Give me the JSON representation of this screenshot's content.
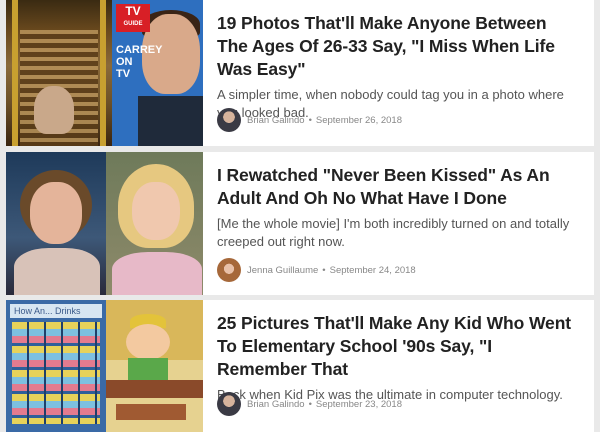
{
  "articles": [
    {
      "title": "19 Photos That'll Make Anyone Between The Ages Of 26-33 Say, \"I Miss When Life Was Easy\"",
      "description": "A simpler time, when nobody could tag you in a photo where you looked bad.",
      "author": "Brian Galindo",
      "date": "September 26, 2018",
      "thumb_text": {
        "tv_logo": "TV",
        "tv_logo_sub": "GUIDE",
        "cover_line": "CARREY ON TV"
      }
    },
    {
      "title": "I Rewatched \"Never Been Kissed\" As An Adult And Oh No What Have I Done",
      "description": "[Me the whole movie] I'm both incredibly turned on and totally creeped out right now.",
      "author": "Jenna Guillaume",
      "date": "September 24, 2018"
    },
    {
      "title": "25 Pictures That'll Make Any Kid Who Went To Elementary School '90s Say, \"I Remember That",
      "description": "Back when Kid Pix was the ultimate in computer technology.",
      "author": "Brian Galindo",
      "date": "September 23, 2018",
      "thumb_text": {
        "banner": "How An... Drinks"
      }
    }
  ],
  "separator": "•",
  "icons": [
    "author-avatar-icon"
  ]
}
